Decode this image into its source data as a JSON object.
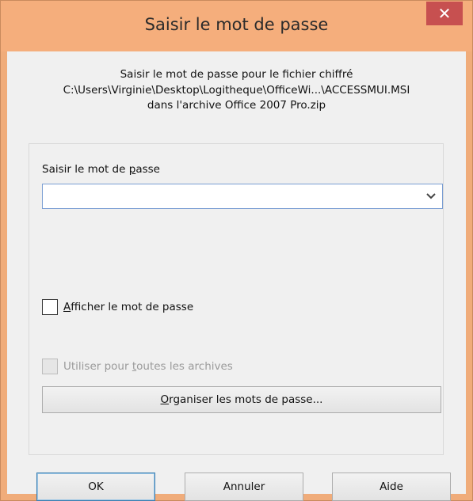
{
  "window": {
    "title": "Saisir le mot de passe",
    "close_glyph": "✕"
  },
  "description": {
    "line1": "Saisir le mot de passe pour le fichier chiffré",
    "line2": "C:\\Users\\Virginie\\Desktop\\Logitheque\\OfficeWi...\\ACCESSMUI.MSI",
    "line3": "dans l'archive Office 2007 Pro.zip"
  },
  "password": {
    "label_pre": "Saisir le mot de ",
    "label_key": "p",
    "label_post": "asse",
    "value": "",
    "dropdown_icon": "chevron-down-icon"
  },
  "show_password": {
    "label_key": "A",
    "label_rest": "fficher le mot de passe",
    "checked": false
  },
  "use_all": {
    "label_pre": "Utiliser pour ",
    "label_key": "t",
    "label_post": "outes les archives",
    "checked": false,
    "disabled": true
  },
  "manage_button": {
    "label_key": "O",
    "label_rest": "rganiser les mots de passe..."
  },
  "buttons": {
    "ok": "OK",
    "cancel": "Annuler",
    "help": "Aide"
  },
  "colors": {
    "title_bar": "#f5ae7c",
    "close_button": "#c75050",
    "dialog_bg": "#f0f0f0",
    "input_border": "#7a9ed3"
  }
}
